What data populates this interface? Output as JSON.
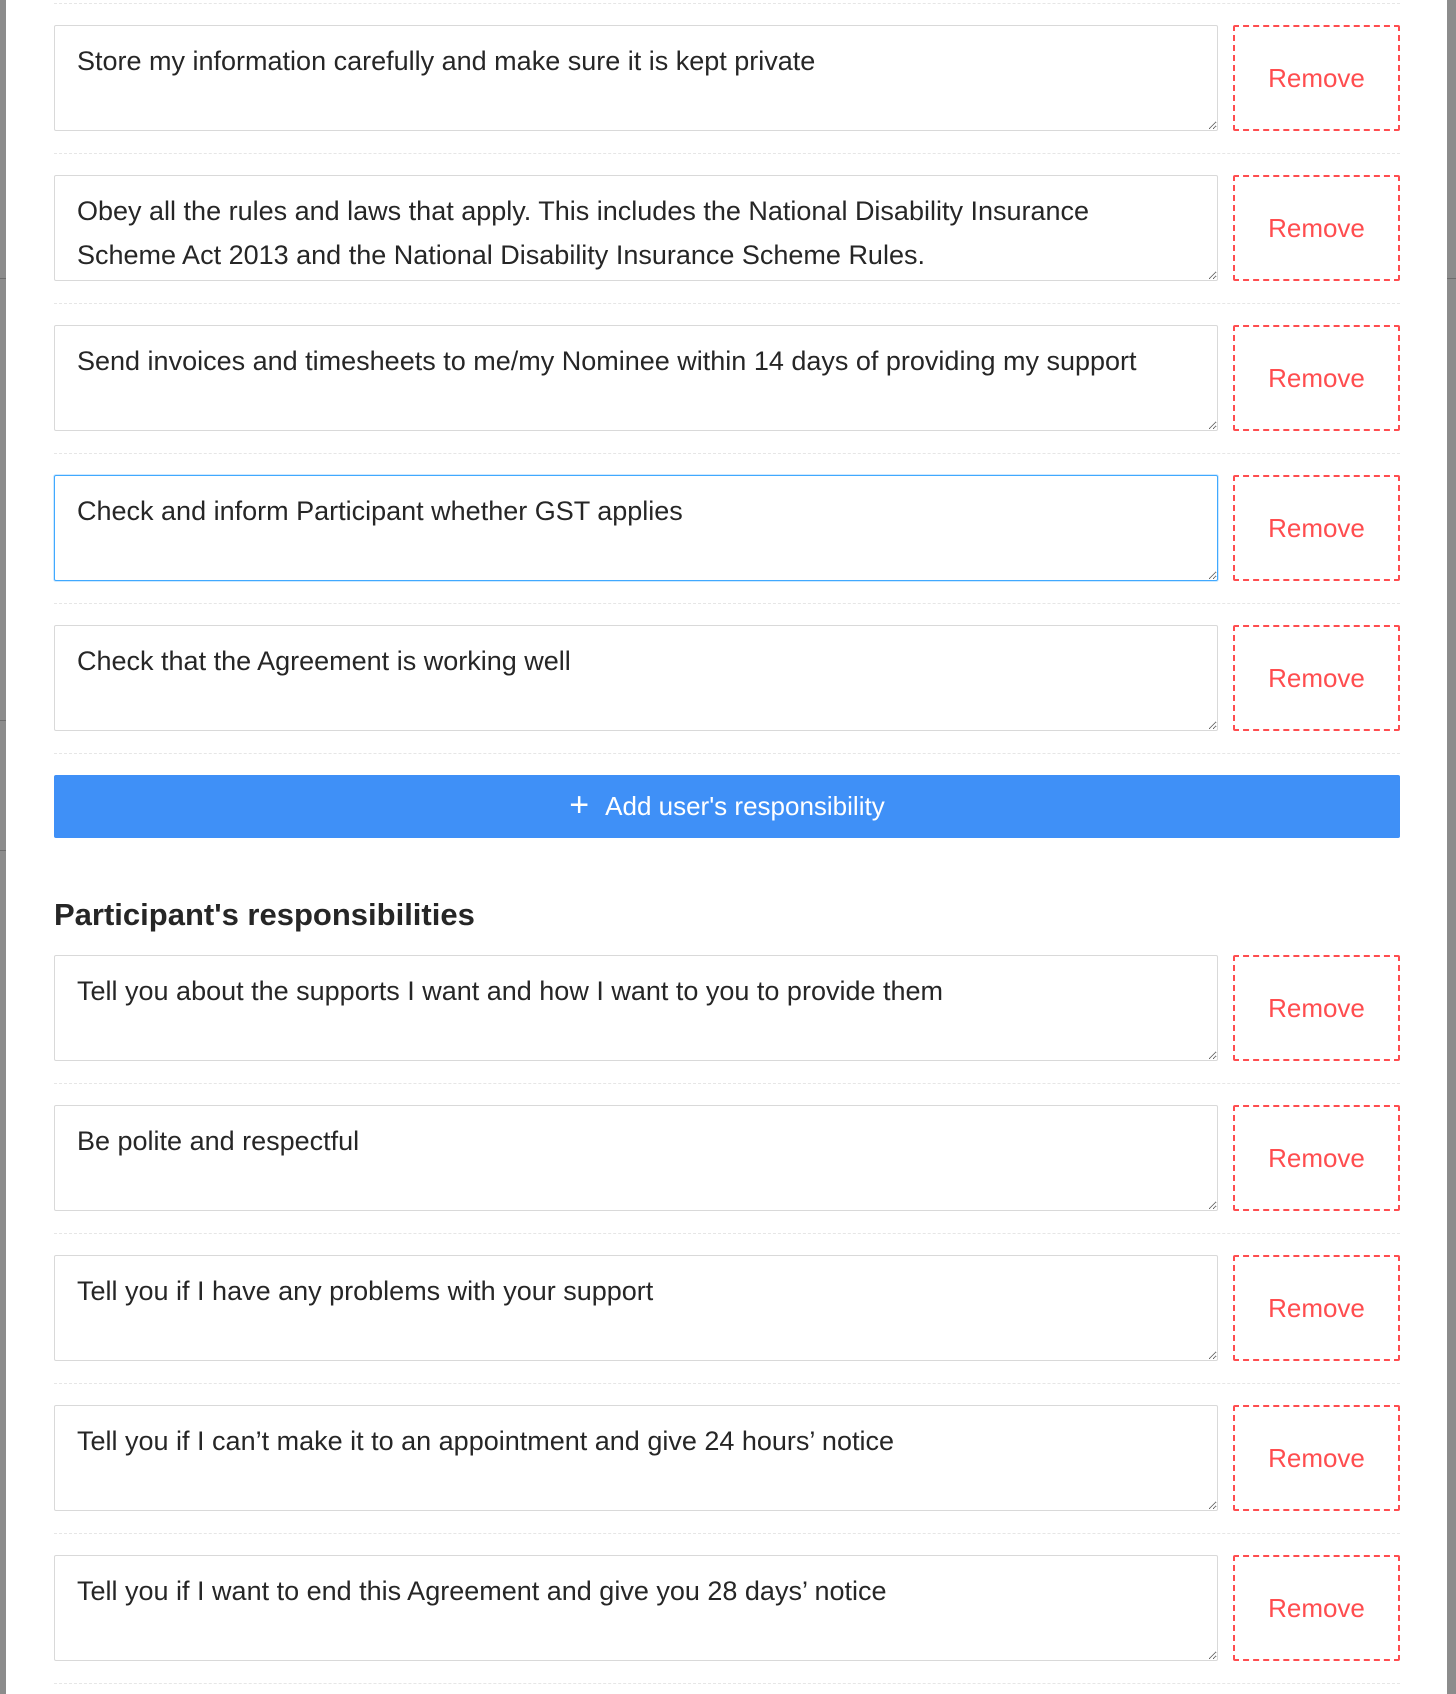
{
  "colors": {
    "primary": "#3f90f7",
    "danger": "#ff4d4f",
    "focus_border": "#40a9ff",
    "text": "#262626"
  },
  "user_responsibilities": {
    "items": [
      {
        "value": "Store my information carefully and make sure it is kept private",
        "remove_label": "Remove"
      },
      {
        "value": "Obey all the rules and laws that apply. This includes the National Disability Insurance Scheme Act 2013 and the National Disability Insurance Scheme Rules.",
        "remove_label": "Remove"
      },
      {
        "value": "Send invoices and timesheets to me/my Nominee within 14 days of providing my support",
        "remove_label": "Remove"
      },
      {
        "value": "Check and inform Participant whether GST applies",
        "remove_label": "Remove"
      },
      {
        "value": "Check that the Agreement is working well",
        "remove_label": "Remove"
      }
    ],
    "add_button": {
      "icon": "plus-icon",
      "icon_glyph": "+",
      "label": "Add user's responsibility"
    }
  },
  "participant_responsibilities": {
    "title": "Participant's responsibilities",
    "items": [
      {
        "value": "Tell you about the supports I want and how I want to you to provide them",
        "remove_label": "Remove"
      },
      {
        "value": "Be polite and respectful",
        "remove_label": "Remove"
      },
      {
        "value": "Tell you if I have any problems with your support",
        "remove_label": "Remove"
      },
      {
        "value": "Tell you if I can’t make it to an appointment and give 24 hours’ notice",
        "remove_label": "Remove"
      },
      {
        "value": "Tell you if I want to end this Agreement and give you 28 days’ notice",
        "remove_label": "Remove"
      }
    ]
  },
  "focused_field": "user_responsibilities.items.3"
}
